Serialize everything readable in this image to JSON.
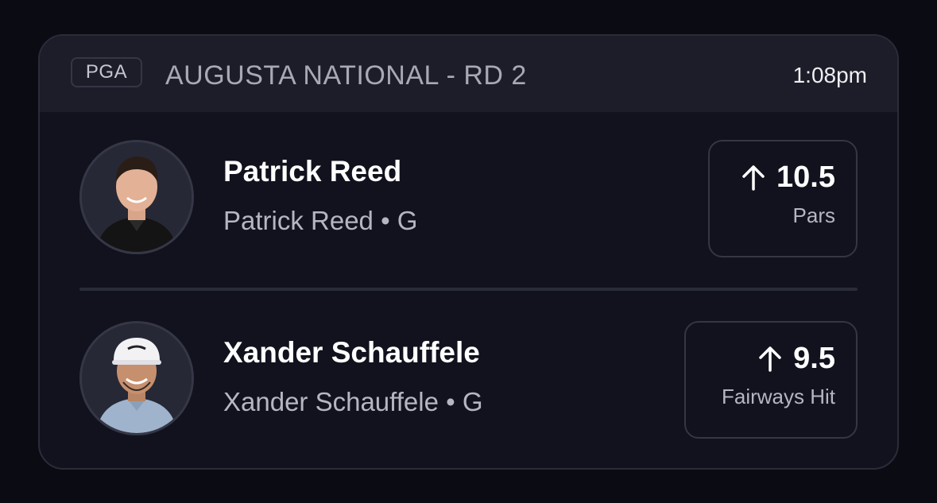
{
  "header": {
    "league": "PGA",
    "event": "AUGUSTA NATIONAL - RD 2",
    "time": "1:08pm"
  },
  "picks": [
    {
      "name": "Patrick Reed",
      "subtitle": "Patrick Reed • G",
      "direction_icon": "arrow-up-icon",
      "line": "10.5",
      "stat": "Pars",
      "shirt_color": "#141414"
    },
    {
      "name": "Xander Schauffele",
      "subtitle": "Xander Schauffele • G",
      "direction_icon": "arrow-up-icon",
      "line": "9.5",
      "stat": "Fairways Hit",
      "shirt_color": "#9fb3cc"
    }
  ],
  "colors": {
    "background": "#0b0b14",
    "card": "#11121d",
    "header": "#1c1d28",
    "border": "#343644"
  }
}
